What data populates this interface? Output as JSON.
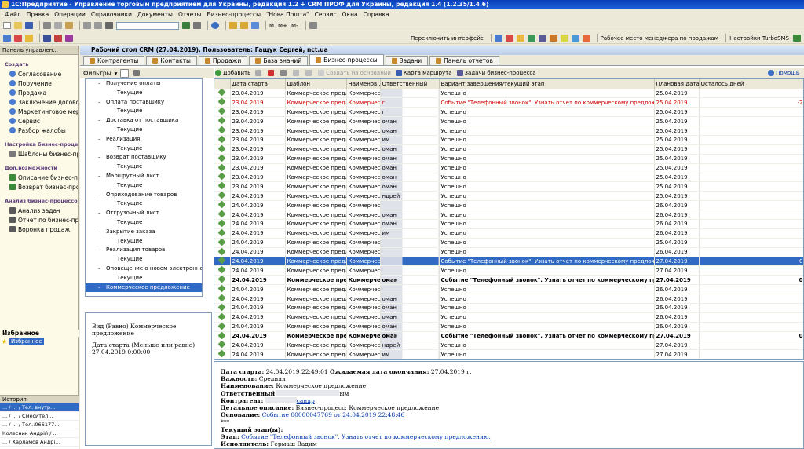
{
  "window": {
    "title": "1С:Предприятие - Управление торговым предприятием для Украины, редакция 1.2 + CRM ПРОФ для Украины, редакция 1.4 (1.2.35/1.4.6)"
  },
  "menu": [
    "Файл",
    "Правка",
    "Операции",
    "Справочники",
    "Документы",
    "Отчеты",
    "Бизнес-процессы",
    "\"Нова Пошта\"",
    "Сервис",
    "Окна",
    "Справка"
  ],
  "toolbar2": {
    "switch_interface": "Переключить интерфейс",
    "workplace": "Рабочее место менеджера по продажам",
    "turbosms": "Настройки TurboSMS",
    "m_labels": [
      "M",
      "M+",
      "M-"
    ]
  },
  "left_panel": {
    "header": "Панель управлен...",
    "sections": [
      {
        "title": "Создать",
        "items": [
          "Согласование",
          "Поручение",
          "Продажа",
          "Заключение договора",
          "Маркетинговое мероприятие",
          "Сервис",
          "Разбор жалобы"
        ]
      },
      {
        "title": "Настройка бизнес-процессов",
        "items": [
          "Шаблоны бизнес-процессов"
        ]
      },
      {
        "title": "Доп.возможности",
        "items": [
          "Описание бизнес-процессов",
          "Возврат бизнес-процессов"
        ]
      },
      {
        "title": "Анализ бизнес-процессов",
        "items": [
          "Анализ задач",
          "Отчет по бизнес-процессам",
          "Воронка продаж"
        ]
      }
    ],
    "favorites_header": "Избранное",
    "favorites_item": "Избранное",
    "history_header": "История",
    "history": [
      "... / ... / Тел. внутр...",
      "... / ... / Смесител...",
      "... / ... / Тел.:066177...",
      "Колесник Андрій / ...",
      "... / Харламов Андрі..."
    ]
  },
  "doc": {
    "title": "Рабочий стол CRM (27.04.2019). Пользователь: Гащук Сергей, nct.ua",
    "tabs": [
      "Контрагенты",
      "Контакты",
      "Продажи",
      "База знаний",
      "Бизнес-процессы",
      "Задачи",
      "Панель отчетов"
    ]
  },
  "filter_label": "Фильтры",
  "actions": {
    "add": "Добавить",
    "create_based": "Создать на основании",
    "route_map": "Карта маршрута",
    "tasks_bp": "Задачи бизнес-процесса",
    "help": "Помощь"
  },
  "tree": [
    {
      "t": "Получение оплаты",
      "lvl": 0
    },
    {
      "t": "Текущие",
      "lvl": 1
    },
    {
      "t": "Оплата поставщику",
      "lvl": 0
    },
    {
      "t": "Текущие",
      "lvl": 1
    },
    {
      "t": "Доставка от поставщика",
      "lvl": 0
    },
    {
      "t": "Текущие",
      "lvl": 1
    },
    {
      "t": "Реализация",
      "lvl": 0
    },
    {
      "t": "Текущие",
      "lvl": 1
    },
    {
      "t": "Возврат поставщику",
      "lvl": 0
    },
    {
      "t": "Текущие",
      "lvl": 1
    },
    {
      "t": "Маршрутный лист",
      "lvl": 0
    },
    {
      "t": "Текущие",
      "lvl": 1
    },
    {
      "t": "Оприходование товаров",
      "lvl": 0
    },
    {
      "t": "Текущие",
      "lvl": 1
    },
    {
      "t": "Отгрузочный лист",
      "lvl": 0
    },
    {
      "t": "Текущие",
      "lvl": 1
    },
    {
      "t": "Закрытие заказа",
      "lvl": 0
    },
    {
      "t": "Текущие",
      "lvl": 1
    },
    {
      "t": "Реализация товаров",
      "lvl": 0
    },
    {
      "t": "Текущие",
      "lvl": 1
    },
    {
      "t": "Оповещение о новом электронном письме",
      "lvl": 0
    },
    {
      "t": "Текущие",
      "lvl": 1
    },
    {
      "t": "Коммерческое предложение",
      "lvl": 0,
      "sel": true
    }
  ],
  "filter_info": {
    "line1": "Вид (Равно) Коммерческое предложение",
    "line2": "Дата старта (Меньше или равно) 27.04.2019 0:00:00"
  },
  "grid": {
    "columns": [
      "",
      "Дата старта",
      "Шаблон",
      "Наименов...",
      "Ответственный",
      "Вариант завершения/текущий этап",
      "Плановая дата",
      "Осталось дней"
    ],
    "rows": [
      {
        "d": "23.04.2019",
        "s": "Коммерческое предл...",
        "n": "Коммерчес...",
        "r": "",
        "v": "Успешно",
        "p": "25.04.2019",
        "o": "",
        "c": ""
      },
      {
        "d": "23.04.2019",
        "s": "Коммерческое предл...",
        "n": "Коммерчес...",
        "r": "г",
        "v": "Событие \"Телефонный звонок\". Узнать отчет по коммерческому предложению.",
        "p": "25.04.2019",
        "o": "-2",
        "c": "red"
      },
      {
        "d": "23.04.2019",
        "s": "Коммерческое предл...",
        "n": "Коммерчес...",
        "r": "г",
        "v": "Успешно",
        "p": "25.04.2019",
        "o": "",
        "c": ""
      },
      {
        "d": "23.04.2019",
        "s": "Коммерческое предл...",
        "n": "Коммерчес...",
        "r": "оман",
        "v": "Успешно",
        "p": "25.04.2019",
        "o": "",
        "c": ""
      },
      {
        "d": "23.04.2019",
        "s": "Коммерческое предл...",
        "n": "Коммерчес...",
        "r": "оман",
        "v": "Успешно",
        "p": "25.04.2019",
        "o": "",
        "c": ""
      },
      {
        "d": "23.04.2019",
        "s": "Коммерческое предл...",
        "n": "Коммерчес...",
        "r": "им",
        "v": "Успешно",
        "p": "25.04.2019",
        "o": "",
        "c": ""
      },
      {
        "d": "23.04.2019",
        "s": "Коммерческое предл...",
        "n": "Коммерчес...",
        "r": "оман",
        "v": "Успешно",
        "p": "25.04.2019",
        "o": "",
        "c": ""
      },
      {
        "d": "23.04.2019",
        "s": "Коммерческое предл...",
        "n": "Коммерчес...",
        "r": "оман",
        "v": "Успешно",
        "p": "25.04.2019",
        "o": "",
        "c": ""
      },
      {
        "d": "23.04.2019",
        "s": "Коммерческое предл...",
        "n": "Коммерчес...",
        "r": "оман",
        "v": "Успешно",
        "p": "25.04.2019",
        "o": "",
        "c": ""
      },
      {
        "d": "23.04.2019",
        "s": "Коммерческое предл...",
        "n": "Коммерчес...",
        "r": "оман",
        "v": "Успешно",
        "p": "25.04.2019",
        "o": "",
        "c": ""
      },
      {
        "d": "23.04.2019",
        "s": "Коммерческое предл...",
        "n": "Коммерчес...",
        "r": "оман",
        "v": "Успешно",
        "p": "25.04.2019",
        "o": "",
        "c": ""
      },
      {
        "d": "24.04.2019",
        "s": "Коммерческое предл...",
        "n": "Коммерчес...",
        "r": "ндрей",
        "v": "Успешно",
        "p": "25.04.2019",
        "o": "",
        "c": ""
      },
      {
        "d": "24.04.2019",
        "s": "Коммерческое предл...",
        "n": "Коммерчес...",
        "r": "",
        "v": "Успешно",
        "p": "26.04.2019",
        "o": "",
        "c": ""
      },
      {
        "d": "24.04.2019",
        "s": "Коммерческое предл...",
        "n": "Коммерчес...",
        "r": "оман",
        "v": "Успешно",
        "p": "26.04.2019",
        "o": "",
        "c": ""
      },
      {
        "d": "24.04.2019",
        "s": "Коммерческое предл...",
        "n": "Коммерчес...",
        "r": "оман",
        "v": "Успешно",
        "p": "26.04.2019",
        "o": "",
        "c": ""
      },
      {
        "d": "24.04.2019",
        "s": "Коммерческое предл...",
        "n": "Коммерчес...",
        "r": "им",
        "v": "Успешно",
        "p": "26.04.2019",
        "o": "",
        "c": ""
      },
      {
        "d": "24.04.2019",
        "s": "Коммерческое предл...",
        "n": "Коммерчес...",
        "r": "",
        "v": "Успешно",
        "p": "25.04.2019",
        "o": "",
        "c": ""
      },
      {
        "d": "24.04.2019",
        "s": "Коммерческое предл...",
        "n": "Коммерчес...",
        "r": "",
        "v": "Успешно",
        "p": "26.04.2019",
        "o": "",
        "c": ""
      },
      {
        "d": "24.04.2019",
        "s": "Коммерческое предл...",
        "n": "Коммерчес...",
        "r": "",
        "v": "Событие \"Телефонный звонок\". Узнать отчет по коммерческому предложению.",
        "p": "27.04.2019",
        "o": "0",
        "c": "sel"
      },
      {
        "d": "24.04.2019",
        "s": "Коммерческое предл...",
        "n": "Коммерчес...",
        "r": "",
        "v": "Успешно",
        "p": "27.04.2019",
        "o": "",
        "c": ""
      },
      {
        "d": "24.04.2019",
        "s": "Коммерческое предл...",
        "n": "Коммерчес...",
        "r": "оман",
        "v": "Событие \"Телефонный звонок\". Узнать отчет по коммерческому предложению.",
        "p": "27.04.2019",
        "o": "0",
        "c": "bold"
      },
      {
        "d": "24.04.2019",
        "s": "Коммерческое предл...",
        "n": "Коммерчес...",
        "r": "",
        "v": "Успешно",
        "p": "26.04.2019",
        "o": "",
        "c": ""
      },
      {
        "d": "24.04.2019",
        "s": "Коммерческое предл...",
        "n": "Коммерчес...",
        "r": "оман",
        "v": "Успешно",
        "p": "26.04.2019",
        "o": "",
        "c": ""
      },
      {
        "d": "24.04.2019",
        "s": "Коммерческое предл...",
        "n": "Коммерчес...",
        "r": "оман",
        "v": "Успешно",
        "p": "26.04.2019",
        "o": "",
        "c": ""
      },
      {
        "d": "24.04.2019",
        "s": "Коммерческое предл...",
        "n": "Коммерчес...",
        "r": "оман",
        "v": "Успешно",
        "p": "26.04.2019",
        "o": "",
        "c": ""
      },
      {
        "d": "24.04.2019",
        "s": "Коммерческое предл...",
        "n": "Коммерчес...",
        "r": "оман",
        "v": "Успешно",
        "p": "26.04.2019",
        "o": "",
        "c": ""
      },
      {
        "d": "24.04.2019",
        "s": "Коммерческое предл...",
        "n": "Коммерчес...",
        "r": "оман",
        "v": "Событие \"Телефонный звонок\". Узнать отчет по коммерческому предложению.",
        "p": "27.04.2019",
        "o": "0",
        "c": "bold"
      },
      {
        "d": "24.04.2019",
        "s": "Коммерческое предл...",
        "n": "Коммерчес...",
        "r": "ндрей",
        "v": "Успешно",
        "p": "27.04.2019",
        "o": "",
        "c": ""
      },
      {
        "d": "24.04.2019",
        "s": "Коммерческое предл...",
        "n": "Коммерчес...",
        "r": "им",
        "v": "Успешно",
        "p": "27.04.2019",
        "o": "",
        "c": ""
      }
    ]
  },
  "details": {
    "start_l": "Дата старта:",
    "start_v": "24.04.2019 22:49:01",
    "exp_l": "Ожидаемая дата окончания:",
    "exp_v": "27.04.2019 г.",
    "imp_l": "Важность:",
    "imp_v": "Средняя",
    "name_l": "Наименование:",
    "name_v": "Коммерческое предложение",
    "resp_l": "Ответственный",
    "resp_v": "ым",
    "ctr_l": "Контрагент:",
    "ctr_v": "сандр",
    "desc_l": "Детальное описание:",
    "desc_v": "Бизнес-процесс: Коммерческое предложение",
    "base_l": "Основание:",
    "base_v": "Событие 00000047769 от 24.04.2019 22:48:46",
    "stars": "***",
    "stage_l": "Текущий этап(ы):",
    "step_l": "Этап:",
    "step_v": "Событие \"Телефонный звонок\". Узнать отчет по коммерческому предложению.",
    "exec_l": "Исполнитель:",
    "exec_v": "Гермаш Вадим"
  }
}
